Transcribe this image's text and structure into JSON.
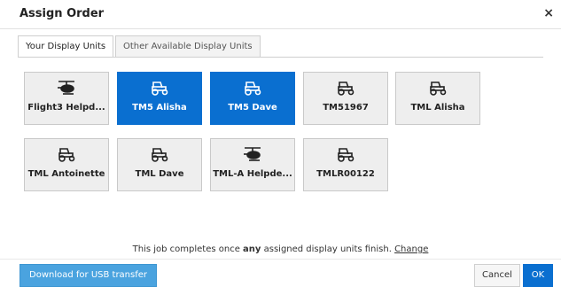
{
  "dialog": {
    "title": "Assign Order",
    "close_label": "×"
  },
  "tabs": [
    {
      "label": "Your Display Units",
      "active": true
    },
    {
      "label": "Other Available Display Units",
      "active": false
    }
  ],
  "units": [
    {
      "label": "Flight3 Helpd...",
      "icon": "helicopter-icon",
      "selected": false
    },
    {
      "label": "TM5 Alisha",
      "icon": "tractor-icon",
      "selected": true
    },
    {
      "label": "TM5 Dave",
      "icon": "tractor-icon",
      "selected": true
    },
    {
      "label": "TM51967",
      "icon": "tractor-icon",
      "selected": false
    },
    {
      "label": "TML Alisha",
      "icon": "tractor-icon",
      "selected": false
    },
    {
      "label": "TML Antoinette",
      "icon": "tractor-icon",
      "selected": false
    },
    {
      "label": "TML Dave",
      "icon": "tractor-icon",
      "selected": false
    },
    {
      "label": "TML-A Helpde...",
      "icon": "helicopter-icon",
      "selected": false
    },
    {
      "label": "TMLR00122",
      "icon": "tractor-icon",
      "selected": false
    }
  ],
  "status": {
    "prefix": "This job completes once ",
    "emphasis": "any",
    "suffix": " assigned display units finish. ",
    "link": "Change"
  },
  "footer": {
    "download_label": "Download for USB transfer",
    "cancel_label": "Cancel",
    "ok_label": "OK"
  },
  "colors": {
    "accent": "#0a6fd0",
    "download": "#4aa3df",
    "tile": "#eeeeee"
  }
}
